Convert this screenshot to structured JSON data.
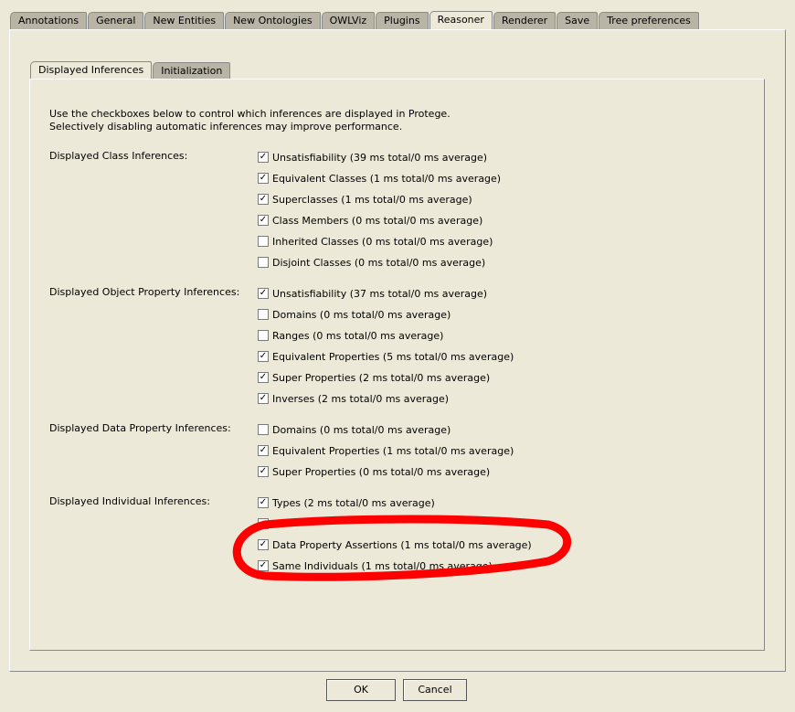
{
  "tabs": [
    "Annotations",
    "General",
    "New Entities",
    "New Ontologies",
    "OWLViz",
    "Plugins",
    "Reasoner",
    "Renderer",
    "Save",
    "Tree preferences"
  ],
  "active_tab": "Reasoner",
  "subtabs": [
    "Displayed Inferences",
    "Initialization"
  ],
  "intro": [
    "Use the checkboxes below to control which inferences are displayed in Protege.",
    "Selectively disabling automatic inferences may improve performance."
  ],
  "groups": [
    {
      "label": "Displayed Class Inferences:",
      "items": [
        {
          "label": "Unsatisfiability (39 ms total/0 ms average)",
          "checked": true
        },
        {
          "label": "Equivalent Classes (1 ms total/0 ms average)",
          "checked": true
        },
        {
          "label": "Superclasses (1 ms total/0 ms average)",
          "checked": true
        },
        {
          "label": "Class Members (0 ms total/0 ms average)",
          "checked": true
        },
        {
          "label": "Inherited Classes (0 ms total/0 ms average)",
          "checked": false
        },
        {
          "label": "Disjoint Classes (0 ms total/0 ms average)",
          "checked": false
        }
      ]
    },
    {
      "label": "Displayed Object Property Inferences:",
      "items": [
        {
          "label": "Unsatisfiability (37 ms total/0 ms average)",
          "checked": true
        },
        {
          "label": "Domains (0 ms total/0 ms average)",
          "checked": false
        },
        {
          "label": "Ranges (0 ms total/0 ms average)",
          "checked": false
        },
        {
          "label": "Equivalent Properties (5 ms total/0 ms average)",
          "checked": true
        },
        {
          "label": "Super Properties (2 ms total/0 ms average)",
          "checked": true
        },
        {
          "label": "Inverses (2 ms total/0 ms average)",
          "checked": true
        }
      ]
    },
    {
      "label": "Displayed Data Property Inferences:",
      "items": [
        {
          "label": "Domains (0 ms total/0 ms average)",
          "checked": false
        },
        {
          "label": "Equivalent Properties (1 ms total/0 ms average)",
          "checked": true
        },
        {
          "label": "Super Properties (0 ms total/0 ms average)",
          "checked": true
        }
      ]
    },
    {
      "label": "Displayed Individual Inferences:",
      "items": [
        {
          "label": "Types (2 ms total/0 ms average)",
          "checked": true
        },
        {
          "label": "",
          "checked": false
        },
        {
          "label": "Data Property Assertions (1 ms total/0 ms average)",
          "checked": true
        },
        {
          "label": "Same Individuals (1 ms total/0 ms average)",
          "checked": true
        }
      ]
    }
  ],
  "buttons": {
    "ok": "OK",
    "cancel": "Cancel"
  },
  "annotation_color": "#ff0000"
}
